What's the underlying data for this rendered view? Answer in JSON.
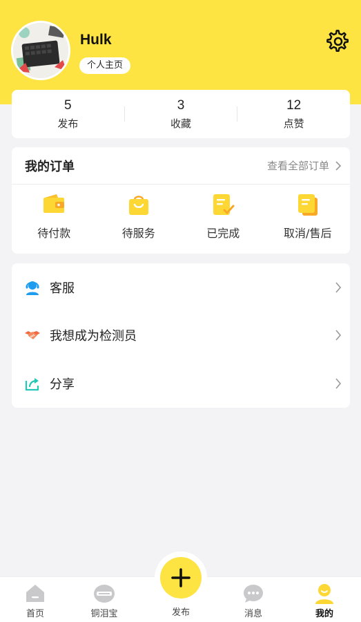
{
  "profile": {
    "username": "Hulk",
    "profile_link_label": "个人主页"
  },
  "stats": [
    {
      "value": "5",
      "label": "发布"
    },
    {
      "value": "3",
      "label": "收藏"
    },
    {
      "value": "12",
      "label": "点赞"
    }
  ],
  "orders": {
    "title": "我的订单",
    "view_all_label": "查看全部订单",
    "items": [
      {
        "label": "待付款",
        "icon": "wallet-icon"
      },
      {
        "label": "待服务",
        "icon": "shopping-bag-icon"
      },
      {
        "label": "已完成",
        "icon": "completed-document-icon"
      },
      {
        "label": "取消/售后",
        "icon": "cancel-document-icon"
      }
    ]
  },
  "menu": [
    {
      "label": "客服",
      "icon": "customer-service-icon"
    },
    {
      "label": "我想成为检测员",
      "icon": "handshake-icon"
    },
    {
      "label": "分享",
      "icon": "share-icon"
    }
  ],
  "tabbar": {
    "items": [
      {
        "label": "首页",
        "icon": "home-icon"
      },
      {
        "label": "铜泪宝",
        "icon": "brand-logo-icon"
      },
      {
        "label": "发布",
        "icon": "plus-icon"
      },
      {
        "label": "消息",
        "icon": "message-icon"
      },
      {
        "label": "我的",
        "icon": "profile-icon"
      }
    ],
    "active_index": 4
  },
  "colors": {
    "accent_yellow": "#fde443",
    "background": "#f3f3f6",
    "icon_blue": "#1e9cf0",
    "icon_orange": "#f26a3d",
    "icon_teal": "#22c8b6",
    "tab_gray": "#c9c9cc"
  }
}
